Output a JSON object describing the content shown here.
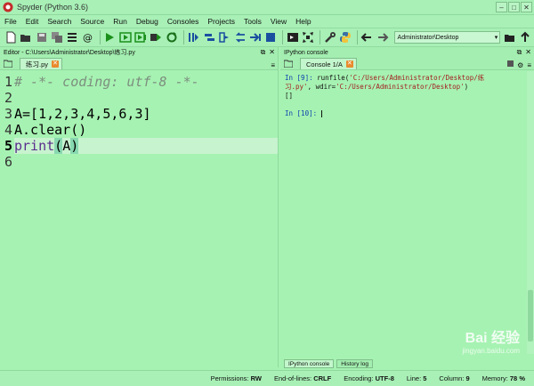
{
  "window": {
    "title": "Spyder (Python 3.6)"
  },
  "menu": [
    "File",
    "Edit",
    "Search",
    "Source",
    "Run",
    "Debug",
    "Consoles",
    "Projects",
    "Tools",
    "View",
    "Help"
  ],
  "toolbar": {
    "path_value": "Administrator\\Desktop",
    "icons": [
      "new-file-icon",
      "open-file-icon",
      "save-icon",
      "save-all-icon",
      "list-icon",
      "at-icon",
      "run-icon",
      "run-cell-icon",
      "run-cell-advance-icon",
      "run-selection-icon",
      "rerun-icon",
      "debug-icon",
      "step-icon",
      "step-into-icon",
      "step-return-icon",
      "continue-icon",
      "stop-icon",
      "maximize-pane-icon",
      "fullscreen-icon",
      "wrench-icon",
      "python-icon",
      "back-arrow-icon",
      "forward-arrow-icon",
      "browse-folder-icon",
      "up-arrow-icon"
    ]
  },
  "editor": {
    "header": "Editor - C:\\Users\\Administrator\\Desktop\\练习.py",
    "tab_label": "练习.py",
    "current_line": 5,
    "lines": [
      {
        "num": "1",
        "text": "# -*- coding: utf-8 -*-"
      },
      {
        "num": "2",
        "text": ""
      },
      {
        "num": "3",
        "text": "A=[1,2,3,4,5,6,3]"
      },
      {
        "num": "4",
        "text": "A.clear()"
      },
      {
        "num": "5",
        "kw": "print",
        "open": "(",
        "arg": "A",
        "close": ")"
      },
      {
        "num": "6",
        "text": ""
      }
    ]
  },
  "console": {
    "header": "IPython console",
    "tab_label": "Console 1/A",
    "in9_prompt": "In [9]:",
    "in9_cmd_a": " runfile(",
    "in9_str_a": "'C:/Users/Administrator/Desktop/练",
    "in9_str_b": "习.py'",
    "in9_cmd_b": ", wdir=",
    "in9_str_c": "'C:/Users/Administrator/Desktop'",
    "in9_cmd_c": ")",
    "output": "[]",
    "in10_prompt": "In [10]:",
    "bottom_tabs": [
      "IPython console",
      "History log"
    ]
  },
  "status": {
    "permissions_label": "Permissions:",
    "permissions": "RW",
    "eol_label": "End-of-lines:",
    "eol": "CRLF",
    "encoding_label": "Encoding:",
    "encoding": "UTF-8",
    "line_label": "Line:",
    "line": "5",
    "column_label": "Column:",
    "column": "9",
    "memory_label": "Memory:",
    "memory": "78 %"
  },
  "watermark": {
    "brand": "Bai 经验",
    "url": "jingyan.baidu.com"
  }
}
